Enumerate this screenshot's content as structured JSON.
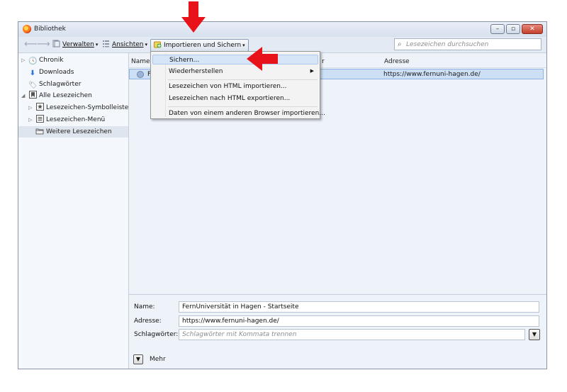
{
  "window": {
    "title": "Bibliothek"
  },
  "toolbar": {
    "back_glyph": "⟵",
    "forward_glyph": "⟶",
    "verwalten": "Verwalten",
    "ansichten": "Ansichten",
    "importieren": "Importieren und Sichern",
    "search_placeholder": "Lesezeichen durchsuchen"
  },
  "sidebar": {
    "items": [
      {
        "label": "Chronik",
        "icon": "clock-icon"
      },
      {
        "label": "Downloads",
        "icon": "download-arrow-icon"
      },
      {
        "label": "Schlagwörter",
        "icon": "tag-icon"
      },
      {
        "label": "Alle Lesezeichen",
        "icon": "bookmarks-folder-icon"
      },
      {
        "label": "Lesezeichen-Symbolleiste",
        "icon": "toolbar-folder-icon"
      },
      {
        "label": "Lesezeichen-Menü",
        "icon": "menu-folder-icon"
      },
      {
        "label": "Weitere Lesezeichen",
        "icon": "folder-icon"
      }
    ]
  },
  "list": {
    "columns": {
      "name": "Name",
      "partial": "r",
      "adresse": "Adresse"
    },
    "row": {
      "name_fragment": "F",
      "adresse": "https://www.fernuni-hagen.de/"
    }
  },
  "menu": {
    "items": [
      {
        "label": "Sichern..."
      },
      {
        "label": "Wiederherstellen"
      },
      {
        "label": "Lesezeichen von HTML importieren..."
      },
      {
        "label": "Lesezeichen nach HTML exportieren..."
      },
      {
        "label": "Daten von einem anderen Browser importieren..."
      }
    ]
  },
  "details": {
    "name_label": "Name:",
    "name_value": "FernUniversität in Hagen - Startseite",
    "adresse_label": "Adresse:",
    "adresse_value": "https://www.fernuni-hagen.de/",
    "tags_label": "Schlagwörter:",
    "tags_placeholder": "Schlagwörter mit Kommata trennen",
    "mehr_label": "Mehr"
  },
  "colors": {
    "arrow": "#e8121a",
    "selection": "#cddff5",
    "window_bg": "#e9eef6"
  }
}
